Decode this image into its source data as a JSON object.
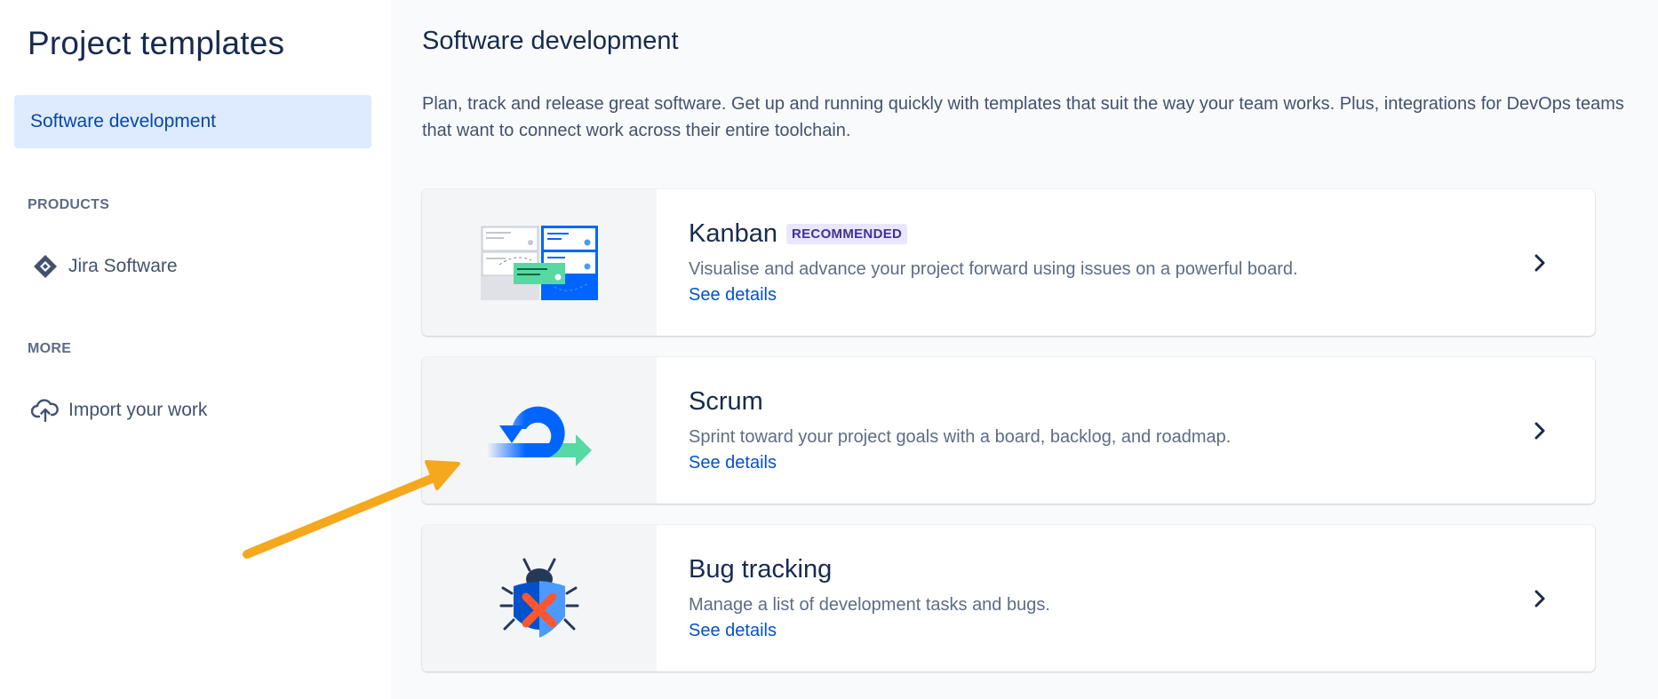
{
  "sidebar": {
    "title": "Project templates",
    "active_item": "Software development",
    "products_heading": "PRODUCTS",
    "products": [
      {
        "label": "Jira Software",
        "icon": "jira-icon"
      }
    ],
    "more_heading": "MORE",
    "more": [
      {
        "label": "Import your work",
        "icon": "cloud-upload-icon"
      }
    ]
  },
  "main": {
    "title": "Software development",
    "description": "Plan, track and release great software. Get up and running quickly with templates that suit the way your team works. Plus, integrations for DevOps teams that want to connect work across their entire toolchain.",
    "cards": [
      {
        "name": "Kanban",
        "badge": "RECOMMENDED",
        "description": "Visualise and advance your project forward using issues on a powerful board.",
        "link": "See details",
        "icon": "kanban-board-icon"
      },
      {
        "name": "Scrum",
        "description": "Sprint toward your project goals with a board, backlog, and roadmap.",
        "link": "See details",
        "icon": "scrum-cycle-icon"
      },
      {
        "name": "Bug tracking",
        "description": "Manage a list of development tasks and bugs.",
        "link": "See details",
        "icon": "bug-icon"
      }
    ]
  },
  "colors": {
    "accent": "#0052cc",
    "active_bg": "#deebff",
    "badge_bg": "#eae6ff",
    "badge_text": "#403294",
    "annotation_arrow": "#f5a81c"
  }
}
